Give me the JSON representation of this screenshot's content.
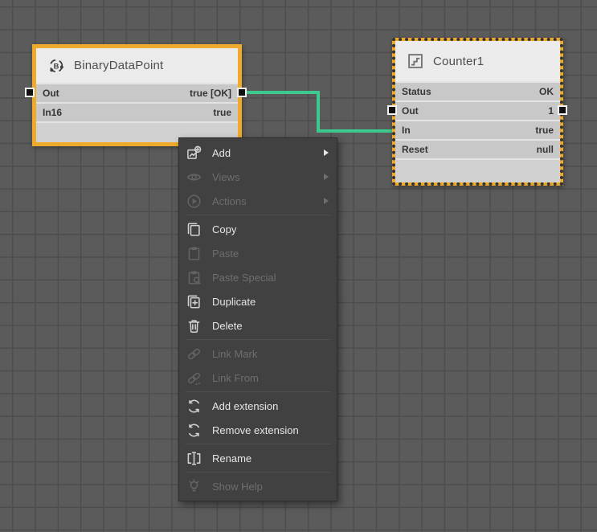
{
  "canvas": {
    "bg": "#5b5b5b",
    "grid_line": "#4d4d4d"
  },
  "wire": {
    "color": "#3ec98e"
  },
  "nodes": [
    {
      "title": "BinaryDataPoint",
      "icon": "binary-point-icon",
      "selection": "solid-orange",
      "rows": [
        {
          "label": "Out",
          "value": "true [OK]"
        },
        {
          "label": "In16",
          "value": "true"
        }
      ]
    },
    {
      "title": "Counter1",
      "icon": "counter-icon",
      "selection": "dotted-orange",
      "rows": [
        {
          "label": "Status",
          "value": "OK"
        },
        {
          "label": "Out",
          "value": "1"
        },
        {
          "label": "In",
          "value": "true"
        },
        {
          "label": "Reset",
          "value": "null"
        }
      ]
    }
  ],
  "context_menu": {
    "items": [
      {
        "label": "Add",
        "icon": "add-icon",
        "enabled": true,
        "submenu": true
      },
      {
        "label": "Views",
        "icon": "views-icon",
        "enabled": false,
        "submenu": true
      },
      {
        "label": "Actions",
        "icon": "actions-icon",
        "enabled": false,
        "submenu": true
      },
      {
        "type": "separator"
      },
      {
        "label": "Copy",
        "icon": "copy-icon",
        "enabled": true,
        "submenu": false
      },
      {
        "label": "Paste",
        "icon": "paste-icon",
        "enabled": false,
        "submenu": false
      },
      {
        "label": "Paste Special",
        "icon": "paste-special-icon",
        "enabled": false,
        "submenu": false
      },
      {
        "label": "Duplicate",
        "icon": "duplicate-icon",
        "enabled": true,
        "submenu": false
      },
      {
        "label": "Delete",
        "icon": "delete-icon",
        "enabled": true,
        "submenu": false
      },
      {
        "type": "separator"
      },
      {
        "label": "Link Mark",
        "icon": "link-mark-icon",
        "enabled": false,
        "submenu": false
      },
      {
        "label": "Link From",
        "icon": "link-from-icon",
        "enabled": false,
        "submenu": false
      },
      {
        "type": "separator"
      },
      {
        "label": "Add extension",
        "icon": "add-extension-icon",
        "enabled": true,
        "submenu": false
      },
      {
        "label": "Remove extension",
        "icon": "remove-extension-icon",
        "enabled": true,
        "submenu": false
      },
      {
        "type": "separator"
      },
      {
        "label": "Rename",
        "icon": "rename-icon",
        "enabled": true,
        "submenu": false
      },
      {
        "type": "separator"
      },
      {
        "label": "Show Help",
        "icon": "show-help-icon",
        "enabled": false,
        "submenu": false
      }
    ]
  }
}
